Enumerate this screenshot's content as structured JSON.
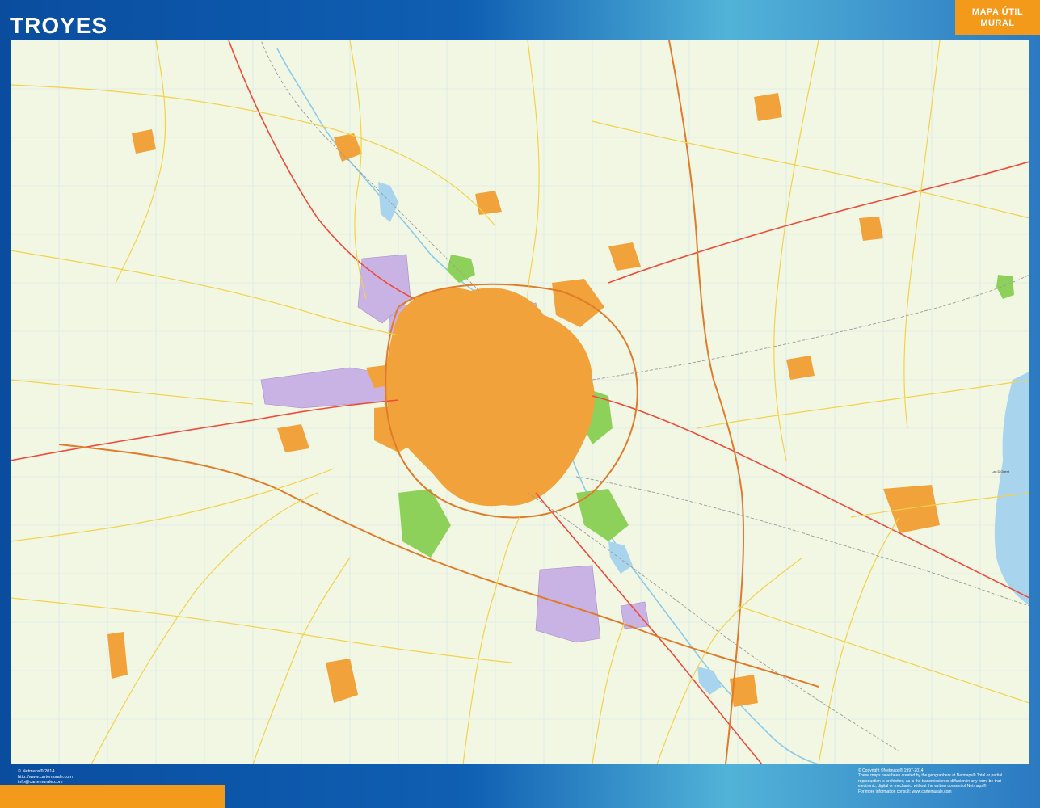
{
  "header": {
    "title": "TROYES",
    "badge_line1": "MAPA ÚTIL",
    "badge_line2": "MURAL"
  },
  "map": {
    "labels": {
      "lake": "Lac D'Orient"
    },
    "colors": {
      "land": "#f2f7e4",
      "urban": "#f2a23a",
      "industrial": "#c9b3e4",
      "park": "#8ed15a",
      "water": "#a9d4ee",
      "motorway": "#e07b2a",
      "main_road": "#ef4b3a",
      "secondary_road": "#f2d24a",
      "railway": "#9a9a9a"
    }
  },
  "footer": {
    "left": {
      "line1": "© Netmaps® 2014",
      "line2": "http://www.cartemurale.com",
      "line3": "info@cartemurale.com"
    },
    "right": {
      "line1": "© Copyright ©Netmaps® 1997-2014",
      "line2": "These maps have been created by the geographers at Netmaps® Total or partial",
      "line3": "reproduction is prohibited; as is the transmission or diffusion in any form, be that",
      "line4": "electronic, digital or mechanic; without the written consent of Netmaps®",
      "line5": "For more information consult: www.cartemurale.com"
    }
  }
}
